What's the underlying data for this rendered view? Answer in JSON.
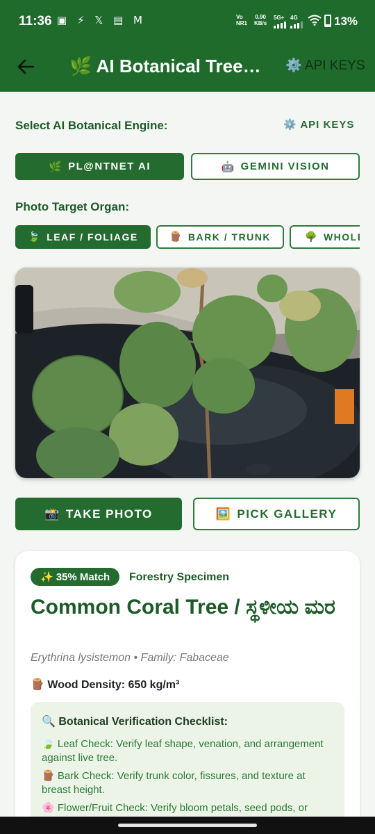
{
  "status_bar": {
    "time": "11:36",
    "notification_icons": "▣ ⚡ 𝕏 ▤ M",
    "network": [
      "Vo",
      "NR1"
    ],
    "speed": [
      "0.90",
      "KB/s"
    ],
    "signal1": "5G+",
    "signal2": "4G",
    "battery_level": 0.13,
    "battery_pct": "13%"
  },
  "app_bar": {
    "back_icon": "arrow-left-icon",
    "title_icon": "🌿",
    "title": "AI Botanical Tree…",
    "api_icon": "⚙️",
    "api_label": "API KEYS"
  },
  "engine": {
    "label": "Select AI Botanical Engine:",
    "api_icon": "⚙️",
    "api_label": "API KEYS",
    "options": [
      {
        "icon": "🌿",
        "label": "PL@NTNET AI",
        "selected": true
      },
      {
        "icon": "🤖",
        "label": "GEMINI VISION",
        "selected": false
      }
    ]
  },
  "organ": {
    "label": "Photo Target Organ:",
    "options": [
      {
        "icon": "🍃",
        "label": "LEAF / FOLIAGE",
        "selected": true
      },
      {
        "icon": "🪵",
        "label": "BARK / TRUNK",
        "selected": false
      },
      {
        "icon": "🌳",
        "label": "WHOLE",
        "selected": false
      }
    ]
  },
  "actions": {
    "take_photo_icon": "📸",
    "take_photo": "TAKE PHOTO",
    "pick_gallery_icon": "🖼️",
    "pick_gallery": "PICK GALLERY"
  },
  "result": {
    "match_icon": "✨",
    "match": "35% Match",
    "tag": "Forestry Specimen",
    "name": "Common Coral Tree / ಸ್ಥಳೀಯ ಮರ",
    "scientific": "Erythrina lysistemon • Family: Fabaceae",
    "density_icon": "🪵",
    "density": "Wood Density: 650 kg/m³",
    "checklist": {
      "title_icon": "🔍",
      "title": "Botanical Verification Checklist:",
      "items": [
        {
          "icon": "🍃",
          "text": "Leaf Check: Verify leaf shape, venation, and arrangement against live tree."
        },
        {
          "icon": "🪵",
          "text": "Bark Check: Verify trunk color, fissures, and texture at breast height."
        },
        {
          "icon": "🌸",
          "text": "Flower/Fruit Check: Verify bloom petals, seed pods, or"
        }
      ]
    }
  },
  "colors": {
    "primary": "#1e6b2c",
    "button": "#236b2e",
    "checklist_bg": "#ebf4e6",
    "text_green": "#1e5a28"
  }
}
